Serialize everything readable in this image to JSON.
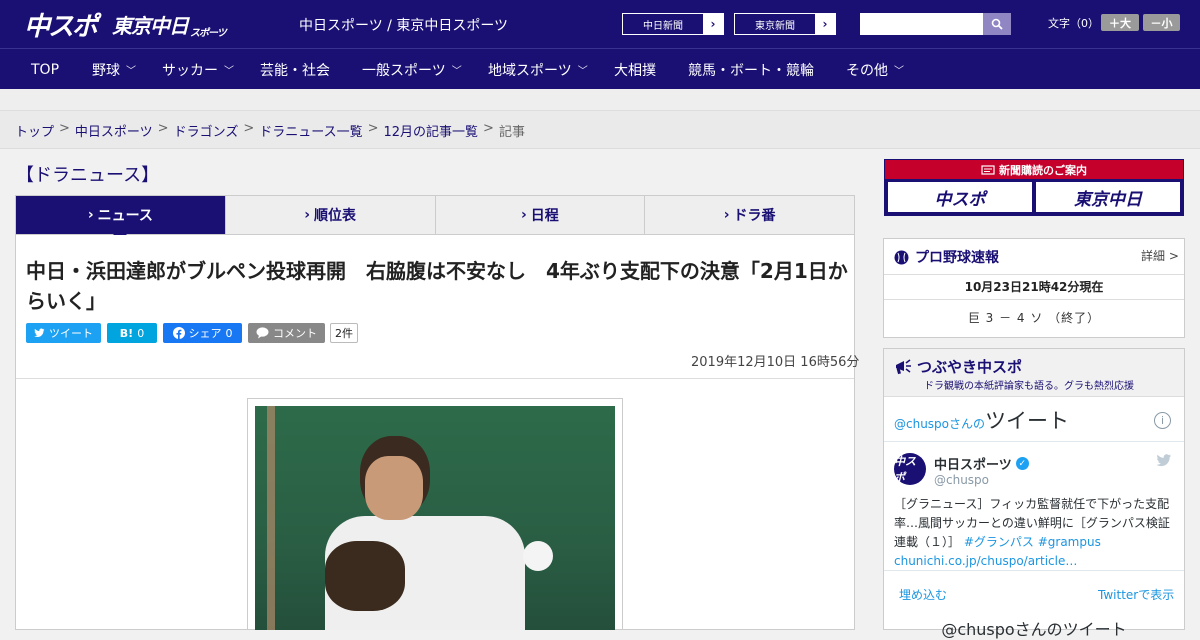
{
  "header": {
    "logo_chuspo": "中スポ",
    "logo_tokyo": "東京中日",
    "logo_tokyo_small": "スポーツ",
    "site_title": "中日スポーツ / 東京中日スポーツ",
    "np_links": [
      {
        "label": "中日新聞"
      },
      {
        "label": "東京新聞"
      }
    ],
    "search_placeholder": "",
    "font_label": "文字（0）",
    "font_up": "＋大",
    "font_down": "－小"
  },
  "nav": {
    "items": [
      {
        "label": "TOP"
      },
      {
        "label": "野球"
      },
      {
        "label": "サッカー"
      },
      {
        "label": "芸能・社会"
      },
      {
        "label": "一般スポーツ"
      },
      {
        "label": "地域スポーツ"
      },
      {
        "label": "大相撲"
      },
      {
        "label": "競馬・ボート・競輪"
      },
      {
        "label": "その他"
      }
    ]
  },
  "breadcrumb": {
    "items": [
      "トップ",
      "中日スポーツ",
      "ドラゴンズ",
      "ドラニュース一覧",
      "12月の記事一覧"
    ],
    "current": "記事",
    "sep": ">"
  },
  "section": {
    "title": "【ドラニュース】"
  },
  "tabs": [
    {
      "label": "ニュース"
    },
    {
      "label": "順位表"
    },
    {
      "label": "日程"
    },
    {
      "label": "ドラ番"
    }
  ],
  "article": {
    "headline": "中日・浜田達郎がブルペン投球再開　右脇腹は不安なし　4年ぶり支配下の決意「2月1日からいく」",
    "share": {
      "tweet": "ツイート",
      "hatena_icon": "B!",
      "hatena_count": "0",
      "fb": "シェア",
      "fb_count": "0",
      "comment": "コメント",
      "comment_count": "2件"
    },
    "date": "2019年12月10日 16時56分"
  },
  "sidebar": {
    "subscribe": {
      "head": "新聞購読のご案内",
      "logo1": "中スポ",
      "logo2": "東京中日"
    },
    "baseball": {
      "title": "プロ野球速報",
      "detail": "詳細 >",
      "time": "10月23日21時42分現在",
      "score": "巨 3 － 4 ソ （終了）"
    },
    "twitter": {
      "title": "つぶやき中スポ",
      "subtitle": "ドラ観戦の本紙評論家も語る。グラも熱烈応援",
      "handle_prefix": "@chuspo",
      "handle_suffix": "さんの",
      "widget_title": "ツイート",
      "info": "i",
      "avatar": "中スポ",
      "name": "中日スポーツ",
      "handle": "@chuspo",
      "text": "［グラニュース］フィッカ監督就任で下がった支配率…風間サッカーとの違い鮮明に［グランパス検証連載（１）］",
      "tags": "#グランパス #grampus",
      "link": "chunichi.co.jp/chuspo/article…",
      "embed": "埋め込む",
      "view": "Twitterで表示",
      "more": "@chuspoさんのツイート"
    }
  }
}
